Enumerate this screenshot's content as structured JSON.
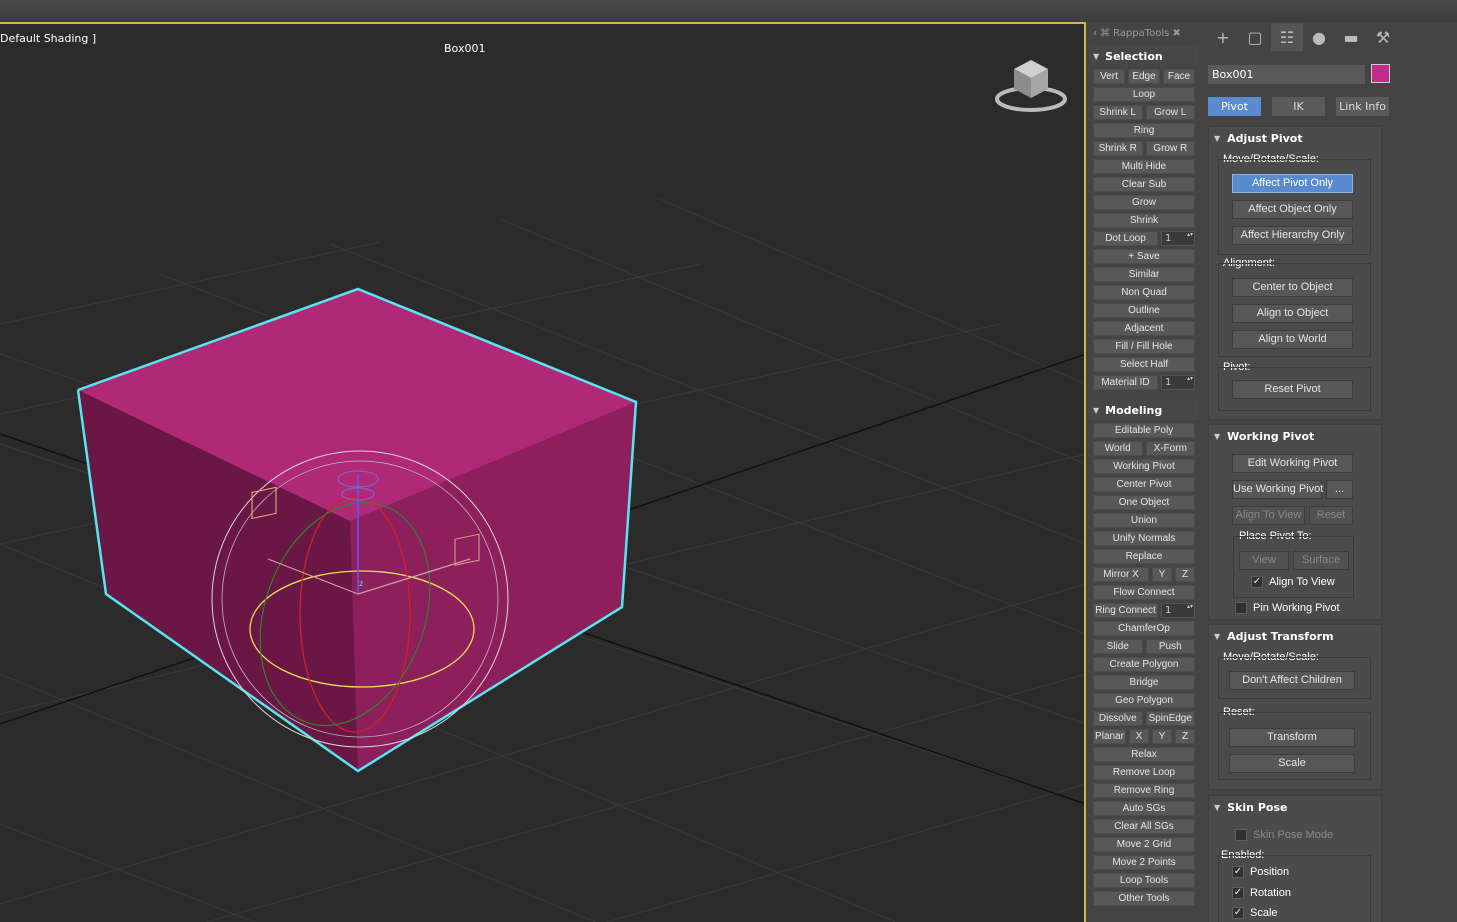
{
  "viewport": {
    "shading_label": "Default Shading ]",
    "object_title": "Box001"
  },
  "rappa": {
    "title": "RappaTools",
    "selection": {
      "header": "Selection",
      "rows": [
        [
          "Vert",
          "Edge",
          "Face"
        ],
        [
          "Loop"
        ],
        [
          "Shrink L",
          "Grow L"
        ],
        [
          "Ring"
        ],
        [
          "Shrink R",
          "Grow R"
        ],
        [
          "Multi Hide"
        ],
        [
          "Clear Sub"
        ],
        [
          "Grow"
        ],
        [
          "Shrink"
        ],
        [
          "Dot Loop",
          "#spin:1"
        ],
        [
          "+ Save"
        ],
        [
          "Similar"
        ],
        [
          "Non Quad"
        ],
        [
          "Outline"
        ],
        [
          "Adjacent"
        ],
        [
          "Fill / Fill Hole"
        ],
        [
          "Select Half"
        ],
        [
          "Material ID",
          "#spin:1"
        ]
      ]
    },
    "modeling": {
      "header": "Modeling",
      "rows": [
        [
          "Editable Poly"
        ],
        [
          "World",
          "X-Form"
        ],
        [
          "Working Pivot"
        ],
        [
          "Center Pivot"
        ],
        [
          "One Object"
        ],
        [
          "Union"
        ],
        [
          "Unify Normals"
        ],
        [
          "Replace"
        ],
        [
          "Mirror X",
          "Y",
          "Z"
        ],
        [
          "Flow Connect"
        ],
        [
          "Ring Connect",
          "#spin:1"
        ],
        [
          "ChamferOp"
        ],
        [
          "Slide",
          "Push"
        ],
        [
          "Create Polygon"
        ],
        [
          "Bridge"
        ],
        [
          "Geo Polygon"
        ],
        [
          "Dissolve",
          "SpinEdge"
        ],
        [
          "Planar",
          "X",
          "Y",
          "Z"
        ],
        [
          "Relax"
        ],
        [
          "Remove Loop"
        ],
        [
          "Remove Ring"
        ],
        [
          "Auto SGs"
        ],
        [
          "Clear All SGs"
        ],
        [
          "Move 2 Grid"
        ],
        [
          "Move 2 Points"
        ],
        [
          "Loop Tools"
        ],
        [
          "Other Tools"
        ]
      ]
    }
  },
  "command_panel": {
    "tabs": [
      "create-icon",
      "modify-icon",
      "hierarchy-icon",
      "motion-icon",
      "display-icon",
      "utilities-icon"
    ],
    "object_name": "Box001",
    "object_color": "#c32b8a",
    "subtabs": [
      "Pivot",
      "IK",
      "Link Info"
    ],
    "adjust_pivot": {
      "header": "Adjust Pivot",
      "move_label": "Move/Rotate/Scale:",
      "affect_pivot": "Affect Pivot Only",
      "affect_object": "Affect Object Only",
      "affect_hierarchy": "Affect Hierarchy Only",
      "alignment_label": "Alignment:",
      "center_to_object": "Center to Object",
      "align_to_object": "Align to Object",
      "align_to_world": "Align to World",
      "pivot_label": "Pivot:",
      "reset_pivot": "Reset Pivot"
    },
    "working_pivot": {
      "header": "Working Pivot",
      "edit": "Edit Working Pivot",
      "use": "Use Working Pivot",
      "dots": "...",
      "align_to_view": "Align To View",
      "reset": "Reset",
      "place_label": "Place Pivot To:",
      "view": "View",
      "surface": "Surface",
      "align_to_view_chk": "Align To View",
      "pin": "Pin Working Pivot"
    },
    "adjust_transform": {
      "header": "Adjust Transform",
      "move_label": "Move/Rotate/Scale:",
      "dont_affect": "Don't Affect Children",
      "reset_label": "Reset:",
      "transform": "Transform",
      "scale": "Scale"
    },
    "skin_pose": {
      "header": "Skin Pose",
      "skin_pose_mode": "Skin Pose Mode",
      "enabled_label": "Enabled:",
      "position": "Position",
      "rotation": "Rotation",
      "scale": "Scale"
    }
  }
}
